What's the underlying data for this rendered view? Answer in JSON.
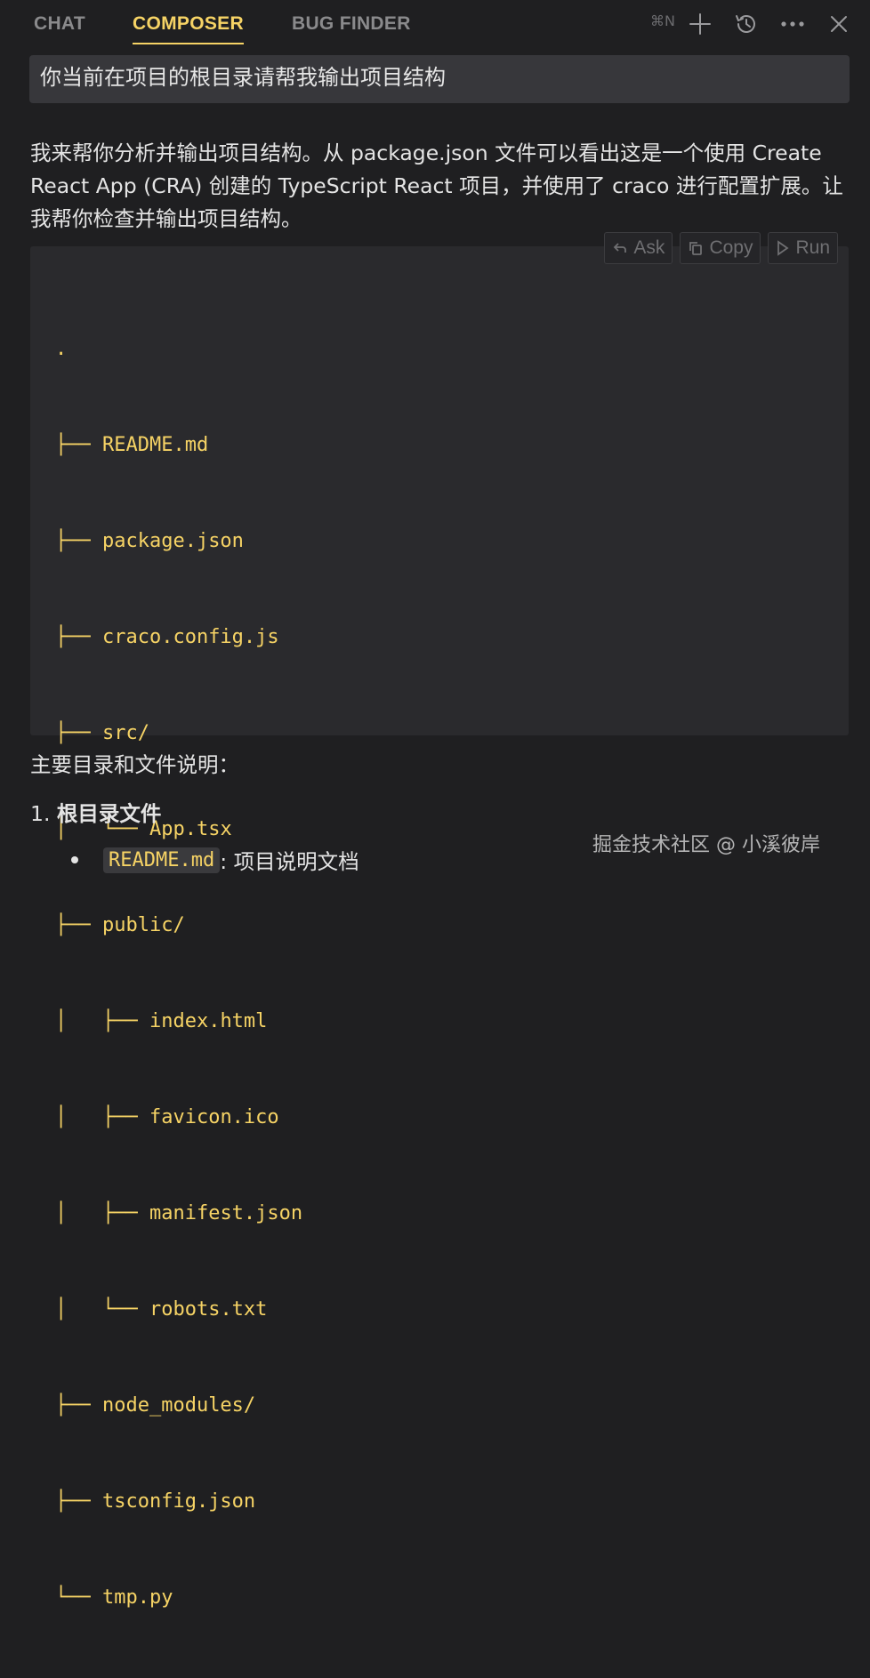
{
  "tabs": [
    {
      "label": "CHAT",
      "active": false
    },
    {
      "label": "COMPOSER",
      "active": true
    },
    {
      "label": "BUG FINDER",
      "active": false
    }
  ],
  "toolbar": {
    "shortcut": "⌘N",
    "icons": [
      "plus-icon",
      "history-icon",
      "more-icon",
      "close-icon"
    ]
  },
  "prompt": {
    "text": "你当前在项目的根目录请帮我输出项目结构"
  },
  "answer": {
    "paragraph": "我来帮你分析并输出项目结构。从 package.json 文件可以看出这是一个使用 Create React App (CRA) 创建的 TypeScript React 项目，并使用了 craco 进行配置扩展。让我帮你检查并输出项目结构。"
  },
  "code": {
    "actions": {
      "ask": "Ask",
      "copy": "Copy",
      "run": "Run"
    },
    "lines": [
      {
        "branch": ".",
        "name": ""
      },
      {
        "branch": "├── ",
        "name": "README.md"
      },
      {
        "branch": "├── ",
        "name": "package.json"
      },
      {
        "branch": "├── ",
        "name": "craco.config.js"
      },
      {
        "branch": "├── ",
        "name": "src/"
      },
      {
        "branch": "│   └── ",
        "name": "App.tsx"
      },
      {
        "branch": "├── ",
        "name": "public/"
      },
      {
        "branch": "│   ├── ",
        "name": "index.html"
      },
      {
        "branch": "│   ├── ",
        "name": "favicon.ico"
      },
      {
        "branch": "│   ├── ",
        "name": "manifest.json"
      },
      {
        "branch": "│   └── ",
        "name": "robots.txt"
      },
      {
        "branch": "├── ",
        "name": "node_modules/"
      },
      {
        "branch": "├── ",
        "name": "tsconfig.json"
      },
      {
        "branch": "└── ",
        "name": "tmp.py"
      }
    ]
  },
  "description": "主要目录和文件说明：",
  "section": {
    "number": "1.",
    "title": "根目录文件"
  },
  "bullet": {
    "code": "README.md",
    "text": ": 项目说明文档"
  },
  "watermark": "掘金技术社区 @ 小溪彼岸"
}
